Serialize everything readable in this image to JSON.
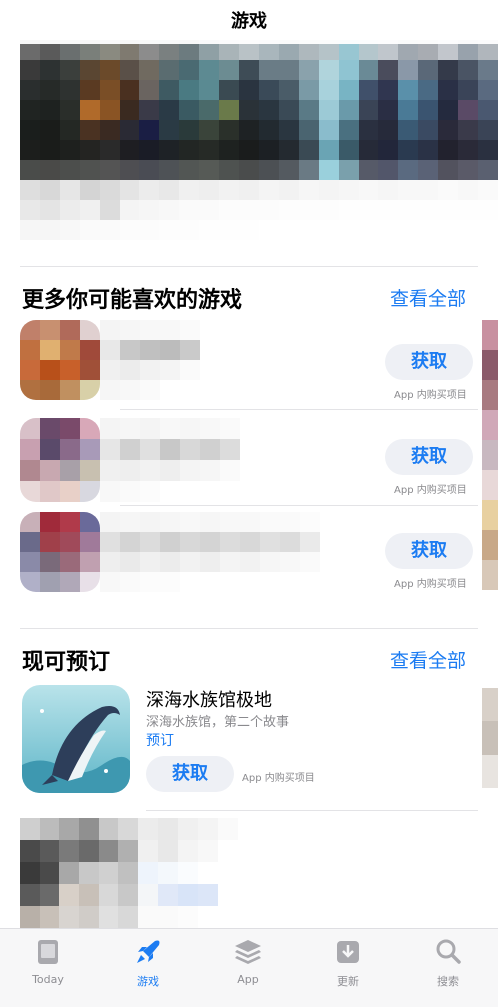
{
  "nav": {
    "title": "游戏"
  },
  "section1": {
    "title": "更多你可能喜欢的游戏",
    "see_all": "查看全部",
    "apps": [
      {
        "get_label": "获取",
        "iap": "App 内购买项目"
      },
      {
        "get_label": "获取",
        "iap": "App 内购买项目"
      },
      {
        "get_label": "获取",
        "iap": "App 内购买项目"
      }
    ]
  },
  "section2": {
    "title": "现可预订",
    "see_all": "查看全部",
    "app": {
      "name": "深海水族馆极地",
      "subtitle": "深海水族馆，第二个故事",
      "status": "预订",
      "get_label": "获取",
      "iap": "App 内购买项目"
    }
  },
  "tabbar": {
    "items": [
      {
        "label": "Today",
        "icon": "today-icon"
      },
      {
        "label": "游戏",
        "icon": "rocket-icon"
      },
      {
        "label": "App",
        "icon": "layers-icon"
      },
      {
        "label": "更新",
        "icon": "download-tray-icon"
      },
      {
        "label": "搜索",
        "icon": "search-icon"
      }
    ],
    "active_index": 1
  },
  "colors": {
    "accent": "#1c7cf2",
    "button_bg": "#eef0f5",
    "tab_inactive": "#8e8e93"
  }
}
